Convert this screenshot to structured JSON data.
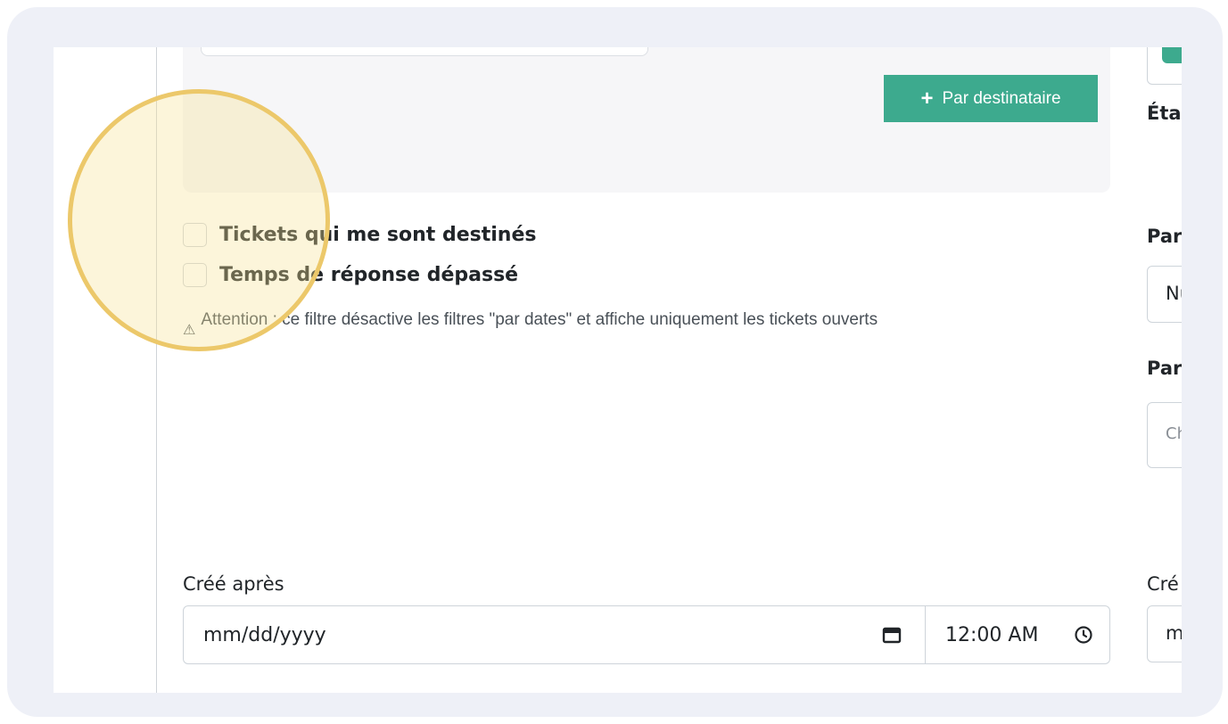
{
  "filters": {
    "add_recipient_button": "Par destinataire",
    "add_recipient_icon": "plus-icon",
    "checkboxes": [
      {
        "label": "Tickets qui me sont destinés",
        "checked": false
      },
      {
        "label": "Temps de réponse dépassé",
        "checked": false
      }
    ],
    "warning_icon": "warning-triangle-icon",
    "warning_text": "Attention : ce filtre désactive les filtres \"par dates\" et affiche uniquement les tickets ouverts",
    "created_after": {
      "label": "Créé après",
      "date_placeholder": "mm/dd/yyyy",
      "time_value": "12:00 AM"
    }
  },
  "right_column": {
    "state_label": "Éta",
    "par_label_1": "Par",
    "select_value": "Nu",
    "par_label_2": "Par",
    "search_placeholder": "Ch",
    "created_label": "Cré",
    "date_value": "m"
  },
  "colors": {
    "accent": "#3daa8e",
    "highlight_ring": "#ecc86a",
    "frame_bg": "#eef0f7"
  }
}
